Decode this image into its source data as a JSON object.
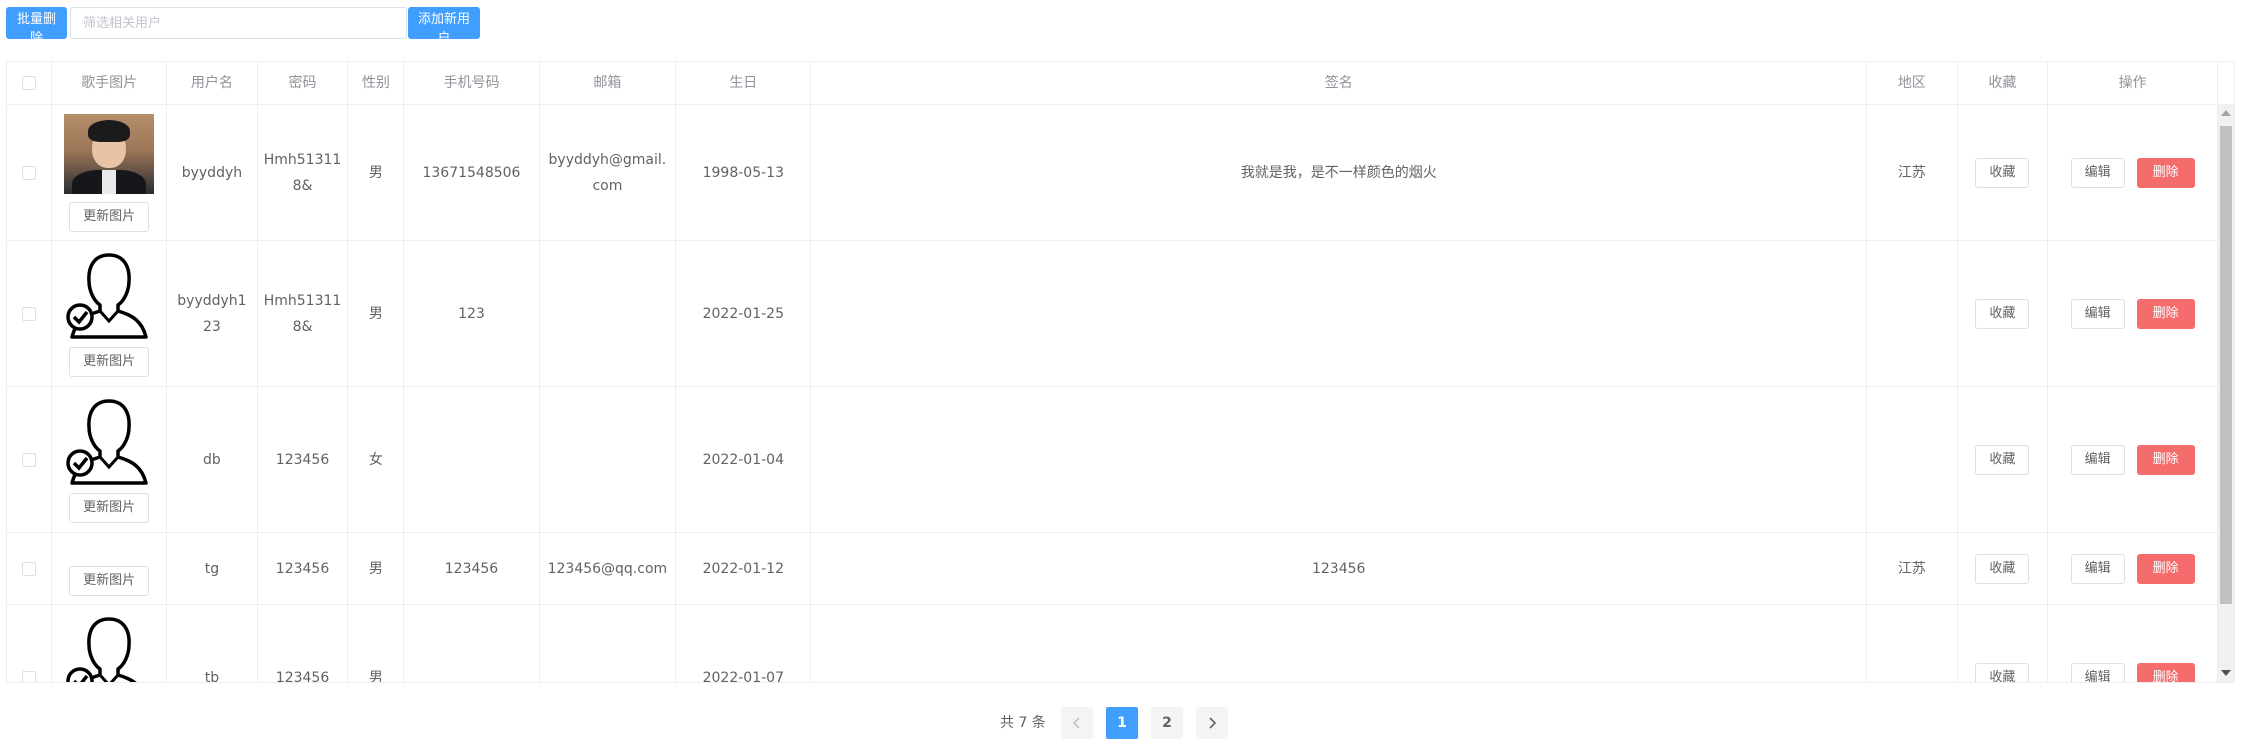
{
  "toolbar": {
    "batch_delete_label": "批量删除",
    "search_placeholder": "筛选相关用户",
    "add_user_label": "添加新用户"
  },
  "table": {
    "headers": [
      "",
      "歌手图片",
      "用户名",
      "密码",
      "性别",
      "手机号码",
      "邮箱",
      "生日",
      "签名",
      "地区",
      "收藏",
      "操作"
    ],
    "update_pic_label": "更新图片",
    "favorite_label": "收藏",
    "edit_label": "编辑",
    "delete_label": "删除",
    "rows": [
      {
        "pic": "photo",
        "username": "byyddyh",
        "password": "Hmh513118&",
        "gender": "男",
        "phone": "13671548506",
        "email": "byyddyh@gmail.com",
        "birthday": "1998-05-13",
        "signature": "我就是我，是不一样颜色的烟火",
        "region": "江苏"
      },
      {
        "pic": "default-avatar",
        "username": "byyddyh123",
        "password": "Hmh513118&",
        "gender": "男",
        "phone": "123",
        "email": "",
        "birthday": "2022-01-25",
        "signature": "",
        "region": ""
      },
      {
        "pic": "default-avatar",
        "username": "db",
        "password": "123456",
        "gender": "女",
        "phone": "",
        "email": "",
        "birthday": "2022-01-04",
        "signature": "",
        "region": ""
      },
      {
        "pic": "none",
        "username": "tg",
        "password": "123456",
        "gender": "男",
        "phone": "123456",
        "email": "123456@qq.com",
        "birthday": "2022-01-12",
        "signature": "123456",
        "region": "江苏"
      },
      {
        "pic": "default-avatar",
        "username": "tb",
        "password": "123456",
        "gender": "男",
        "phone": "",
        "email": "",
        "birthday": "2022-01-07",
        "signature": "",
        "region": ""
      }
    ]
  },
  "pagination": {
    "total_text": "共 7 条",
    "prev_icon": "chevron-left-icon",
    "next_icon": "chevron-right-icon",
    "pages": [
      "1",
      "2"
    ],
    "current_page": "1"
  },
  "colors": {
    "primary": "#409eff",
    "danger": "#f56c6c",
    "border": "#ebeef5"
  }
}
